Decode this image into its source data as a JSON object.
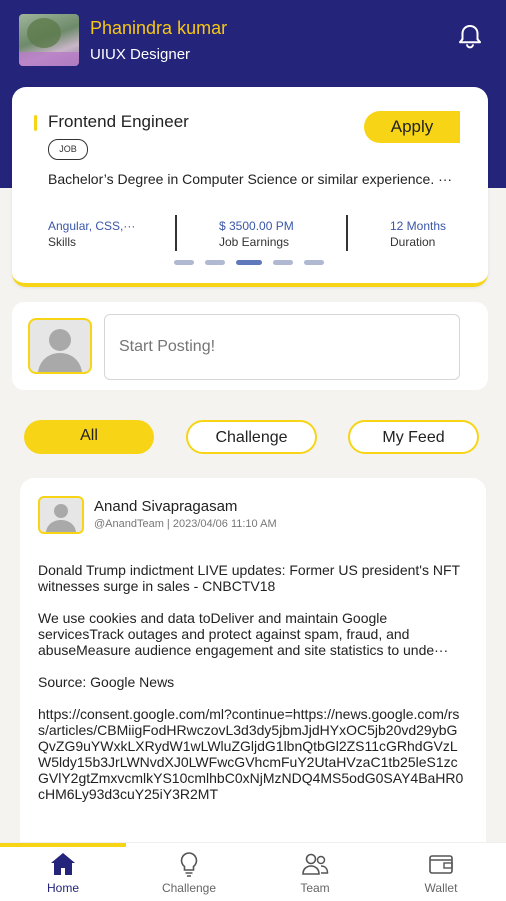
{
  "profile": {
    "name": "Phanindra kumar",
    "role": "UIUX Designer"
  },
  "job": {
    "title": "Frontend  Engineer",
    "tag": "JOB",
    "apply_label": "Apply",
    "description": "Bachelor’s Degree in Computer Science or similar experience. ···",
    "stats": [
      {
        "value": "Angular, CSS,···",
        "label": "Skills"
      },
      {
        "value": "$ 3500.00 PM",
        "label": "Job Earnings"
      },
      {
        "value": "12 Months",
        "label": "Duration"
      }
    ],
    "carousel_active_index": 2
  },
  "composer": {
    "placeholder": "Start Posting!"
  },
  "filters": {
    "all": "All",
    "challenge": "Challenge",
    "my_feed": "My Feed",
    "selected": "All"
  },
  "post": {
    "author": "Anand Sivapragasam",
    "handle_date": "@AnandTeam | 2023/04/06 11:10 AM",
    "headline": "Donald Trump indictment LIVE updates: Former US president's NFT witnesses surge in sales - CNBCTV18",
    "snippet": "We use cookies and data toDeliver and maintain Google servicesTrack outages and protect against spam, fraud, and abuseMeasure audience engagement and site statistics to unde···",
    "source": "Source: Google News",
    "url": "https://consent.google.com/ml?continue=https://news.google.com/rss/articles/CBMiigFodHRwczovL3d3dy5jbmJjdHYxOC5jb20vd29ybGQvZG9uYWxkLXRydW1wLWluZGljdG1lbnQtbGl2ZS11cGRhdGVzLW5ldy15b3JrLWNvdXJ0LWFwcGVhcmFuY2UtaHVzaC1tb25leS1zcGVlY2gtZmxvcmlkYS10cmlhbC0xNjMzNDQ4MS5odG0SAY4BaHR0cHM6Ly93d3cuY25iY3R2MT"
  },
  "tabbar": {
    "items": [
      {
        "label": "Home",
        "icon": "home-icon"
      },
      {
        "label": "Challenge",
        "icon": "lightbulb-icon"
      },
      {
        "label": "Team",
        "icon": "team-icon"
      },
      {
        "label": "Wallet",
        "icon": "wallet-icon"
      }
    ],
    "active": "Home"
  },
  "colors": {
    "header": "#23247a",
    "accent": "#f7d516",
    "link_blue": "#3a57a8",
    "name_yellow": "#f7c715"
  }
}
